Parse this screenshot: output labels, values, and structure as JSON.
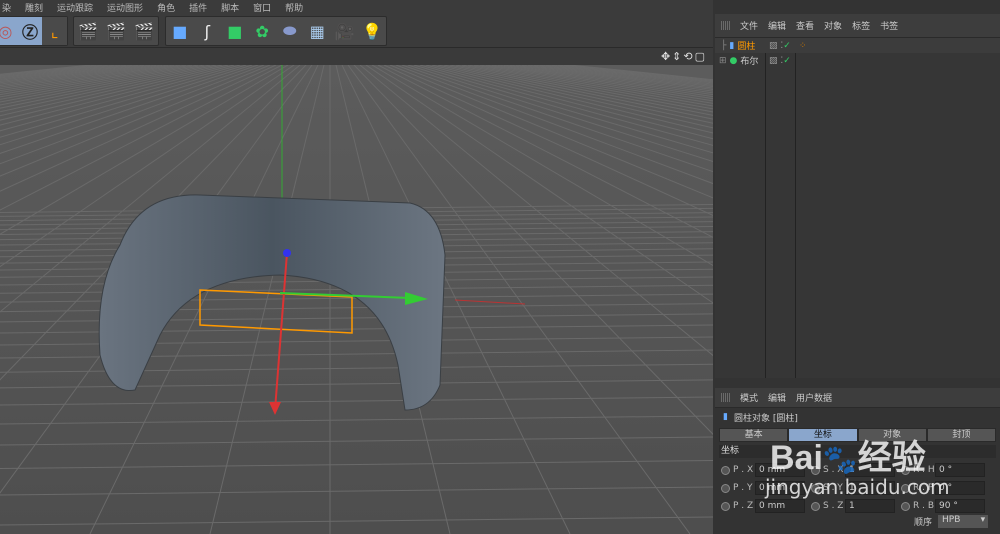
{
  "menu": [
    "染",
    "雕刻",
    "运动跟踪",
    "运动图形",
    "角色",
    "插件",
    "脚本",
    "窗口",
    "帮助"
  ],
  "toolbar_icons": [
    "rotate-icon",
    "z-axis-icon",
    "coordinate-system-icon",
    "render-view-icon",
    "render-picture-icon",
    "render-settings-icon",
    "cube-icon",
    "spline-pen-icon",
    "subdivision-icon",
    "array-icon",
    "deformer-icon",
    "floor-icon",
    "camera-icon",
    "light-icon"
  ],
  "objects_panel": {
    "menu": [
      "文件",
      "编辑",
      "查看",
      "对象",
      "标签",
      "书签"
    ],
    "items": [
      {
        "name": "圆柱",
        "selected": true
      },
      {
        "name": "布尔",
        "selected": false
      }
    ]
  },
  "attributes_panel": {
    "menu": [
      "模式",
      "编辑",
      "用户数据"
    ],
    "title": "圆柱对象 [圆柱]",
    "tabs": [
      "基本",
      "坐标",
      "对象",
      "封顶"
    ],
    "active_tab": "坐标",
    "section": "坐标",
    "fields": [
      [
        {
          "label": "P . X",
          "value": "0 mm"
        },
        {
          "label": "S . X",
          "value": "1"
        },
        {
          "label": "R . H",
          "value": "0 °"
        }
      ],
      [
        {
          "label": "P . Y",
          "value": "0 mm"
        },
        {
          "label": "S . Y",
          "value": "1"
        },
        {
          "label": "R . P",
          "value": "0 °"
        }
      ],
      [
        {
          "label": "P . Z",
          "value": "0 mm"
        },
        {
          "label": "S . Z",
          "value": "1"
        },
        {
          "label": "R . B",
          "value": "90 °"
        }
      ]
    ],
    "order_label": "顺序",
    "order_value": "HPB"
  },
  "watermark": "Baidu经验 jingyan.baidu.com"
}
